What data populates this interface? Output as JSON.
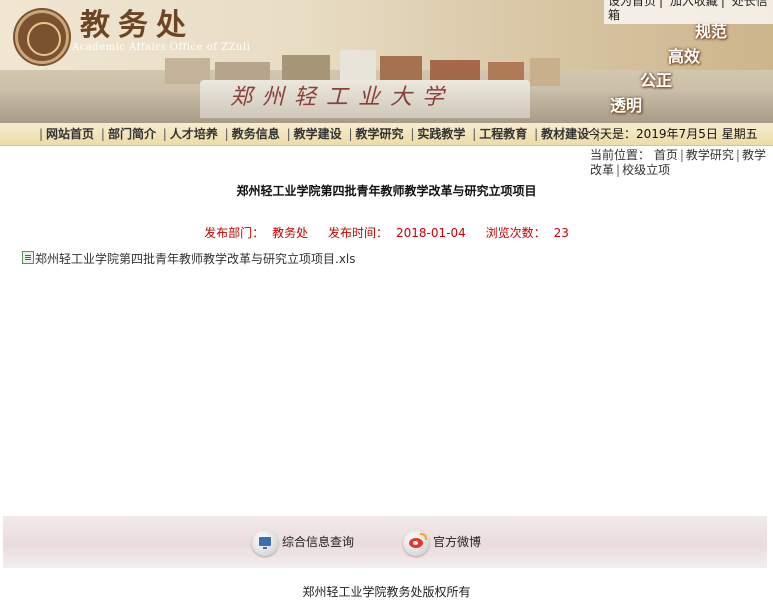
{
  "header": {
    "site_title": "教务处",
    "site_subtitle": "Academic Affairs Office of ZZuli",
    "stone_text": "郑州轻工业大学",
    "slogans": [
      "规范",
      "高效",
      "公正",
      "透明"
    ],
    "top_links": [
      "设为首页",
      "加入收藏",
      "处长信箱"
    ]
  },
  "nav": {
    "items": [
      "网站首页",
      "部门简介",
      "人才培养",
      "教务信息",
      "教学建设",
      "教学研究",
      "实践教学",
      "工程教育",
      "教材建设"
    ],
    "today_label": "今天是：",
    "today_value": "2019年7月5日 星期五"
  },
  "breadcrumb": {
    "label": "当前位置：",
    "items": [
      "首页",
      "教学研究",
      "教学改革",
      "校级立项"
    ]
  },
  "article": {
    "title": "郑州轻工业学院第四批青年教师教学改革与研究立项项目",
    "dept_label": "发布部门：",
    "dept_value": "教务处",
    "time_label": "发布时间：",
    "time_value": "2018-01-04",
    "views_label": "浏览次数：",
    "views_value": "23",
    "attachment": "郑州轻工业学院第四批青年教师教学改革与研究立项项目.xls"
  },
  "footer": {
    "link_info": "综合信息查询",
    "link_weibo": "官方微博",
    "copyright": "郑州轻工业学院教务处版权所有"
  }
}
